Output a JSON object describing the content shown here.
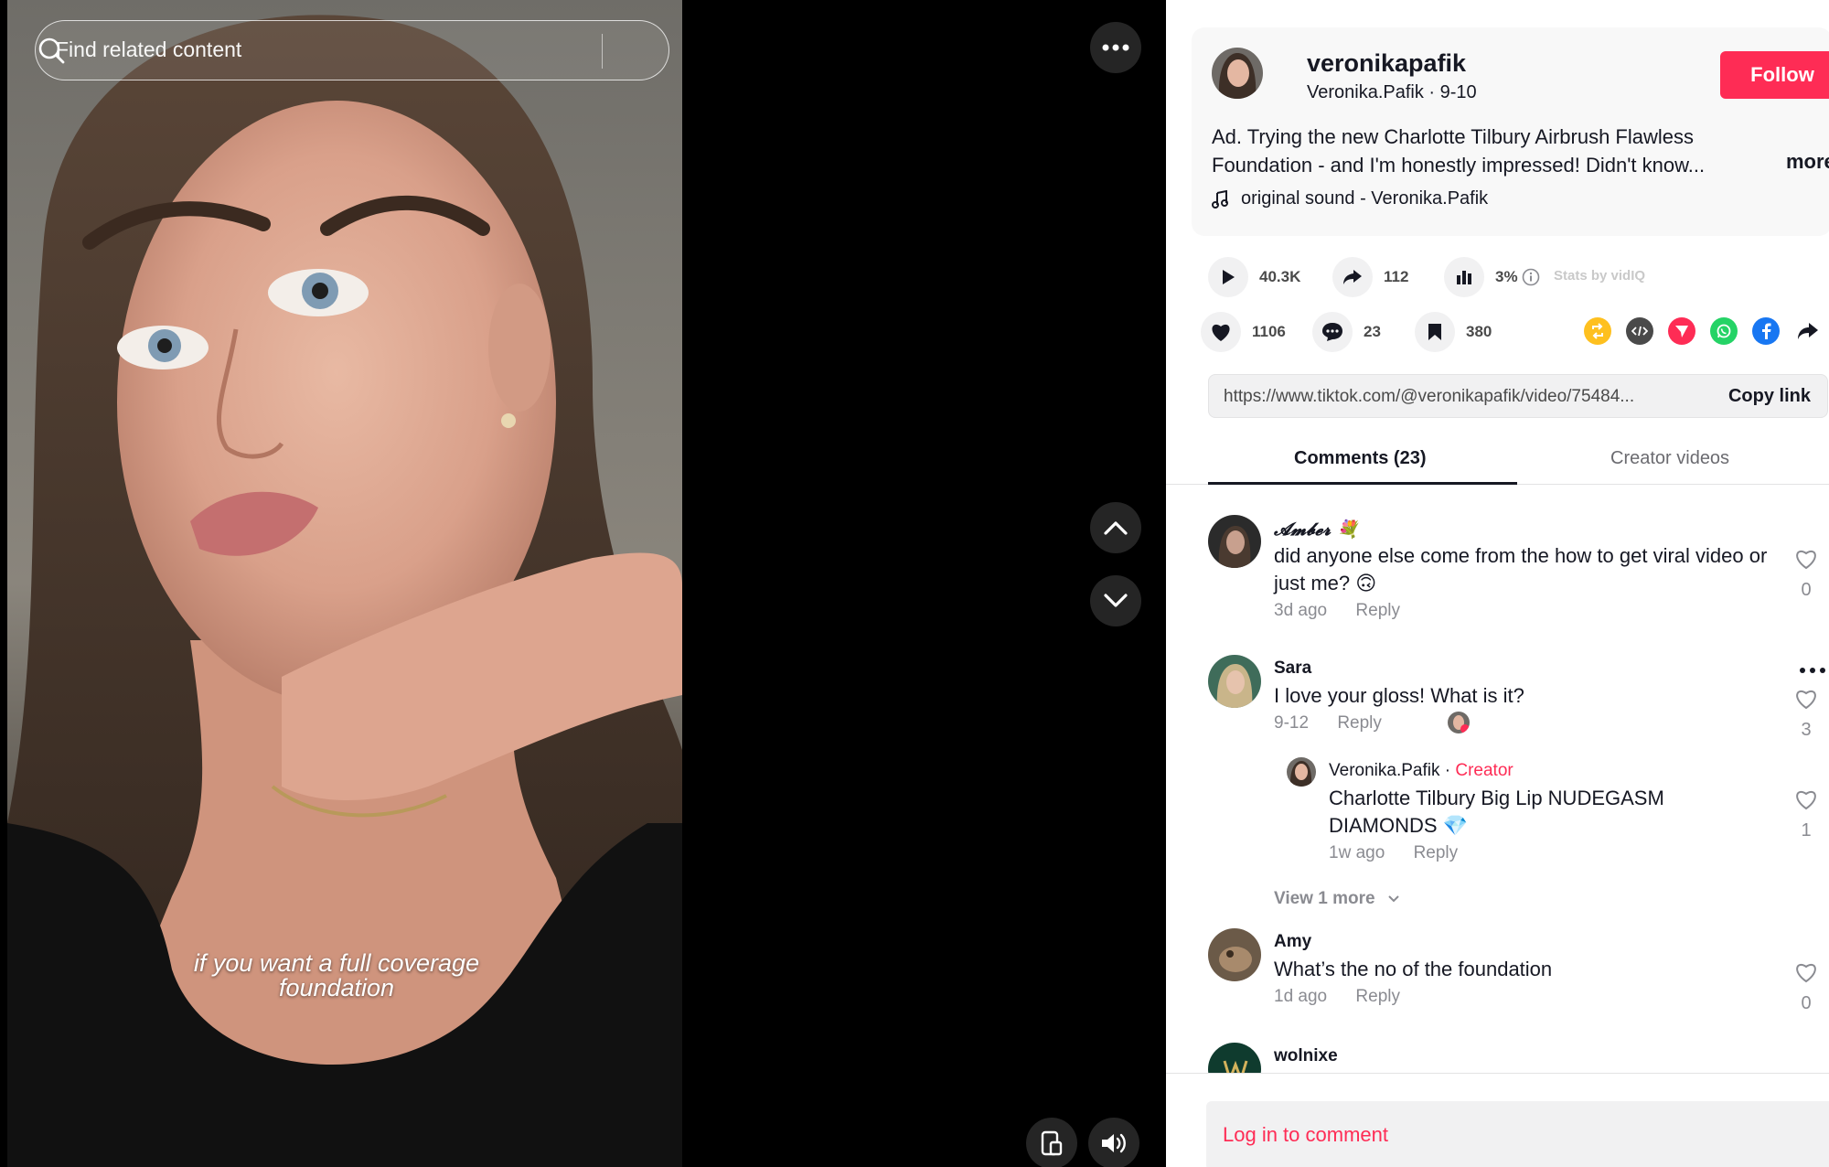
{
  "video": {
    "search_placeholder": "Find related content",
    "caption_line1": "if you want a full coverage",
    "caption_line2": "foundation"
  },
  "post": {
    "username": "veronikapafik",
    "display_name": "Veronika.Pafik",
    "date": "9-10",
    "follow_label": "Follow",
    "description": "Ad. Trying the new Charlotte Tilbury Airbrush Flawless Foundation - and I'm honestly impressed! Didn't know...",
    "more_label": "more",
    "sound": "original sound - Veronika.Pafik"
  },
  "stats": {
    "plays": "40.3K",
    "shares": "112",
    "rate": "3%",
    "stats_by": "Stats by vidIQ",
    "likes": "1106",
    "comments": "23",
    "saves": "380"
  },
  "share_icons": [
    "repost-icon",
    "embed-icon",
    "send-icon",
    "whatsapp-icon",
    "facebook-icon",
    "share-arrow-icon"
  ],
  "link": {
    "url": "https://www.tiktok.com/@veronikapafik/video/75484...",
    "copy_label": "Copy link"
  },
  "tabs": {
    "comments": "Comments (23)",
    "creator": "Creator videos"
  },
  "comments": [
    {
      "name": "𝓐𝓶𝓫𝓮𝓻 💐",
      "text": "did anyone else come from the how to get viral video or just me? 🙃",
      "time": "3d ago",
      "reply": "Reply",
      "likes": "0"
    },
    {
      "name": "Sara",
      "text": "I love your gloss! What is it?",
      "time": "9-12",
      "reply": "Reply",
      "likes": "3",
      "replies": [
        {
          "name": "Veronika.Pafik",
          "sep": " · ",
          "tag": "Creator",
          "text": "Charlotte Tilbury Big Lip NUDEGASM DIAMONDS 💎",
          "time": "1w ago",
          "reply": "Reply",
          "likes": "1"
        }
      ],
      "view_more": "View 1 more"
    },
    {
      "name": "Amy",
      "text": "What’s the no of the foundation",
      "time": "1d ago",
      "reply": "Reply",
      "likes": "0"
    },
    {
      "name": "wolnixe"
    }
  ],
  "footer": {
    "login_label": "Log in to comment"
  },
  "colors": {
    "accent": "#fe2c55",
    "text": "#161823",
    "muted": "#8a8b91"
  }
}
